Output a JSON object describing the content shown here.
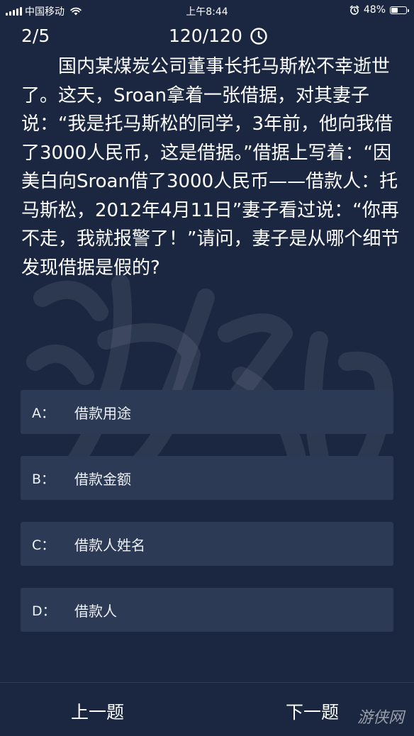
{
  "status_bar": {
    "carrier": "中国移动",
    "time": "上午8:44",
    "battery_percent": "48%",
    "battery_level": 0.48,
    "icons": [
      "signal-icon",
      "wifi-icon",
      "alarm-icon",
      "battery-icon"
    ]
  },
  "quiz": {
    "progress": "2/5",
    "timer": "120/120",
    "question": "国内某煤炭公司董事长托马斯松不幸逝世了。这天，Sroan拿着一张借据，对其妻子说：“我是托马斯松的同学，3年前，他向我借了3000人民币，这是借据。”借据上写着：“因美白向Sroan借了3000人民币——借款人：托马斯松，2012年4月11日”妻子看过说：“你再不走，我就报警了！”请问，妻子是从哪个细节发现借据是假的?",
    "options": [
      {
        "letter": "A：",
        "text": "借款用途"
      },
      {
        "letter": "B：",
        "text": "借款金额"
      },
      {
        "letter": "C：",
        "text": "借款人姓名"
      },
      {
        "letter": "D：",
        "text": "借款人"
      }
    ]
  },
  "navigation": {
    "prev_label": "上一题",
    "next_label": "下一题"
  },
  "watermark": {
    "logo_text": "游侠网",
    "icon": "youxia-watermark"
  },
  "colors": {
    "background": "#1b2740",
    "option_background": "#2c3a56",
    "text": "#ffffff"
  }
}
